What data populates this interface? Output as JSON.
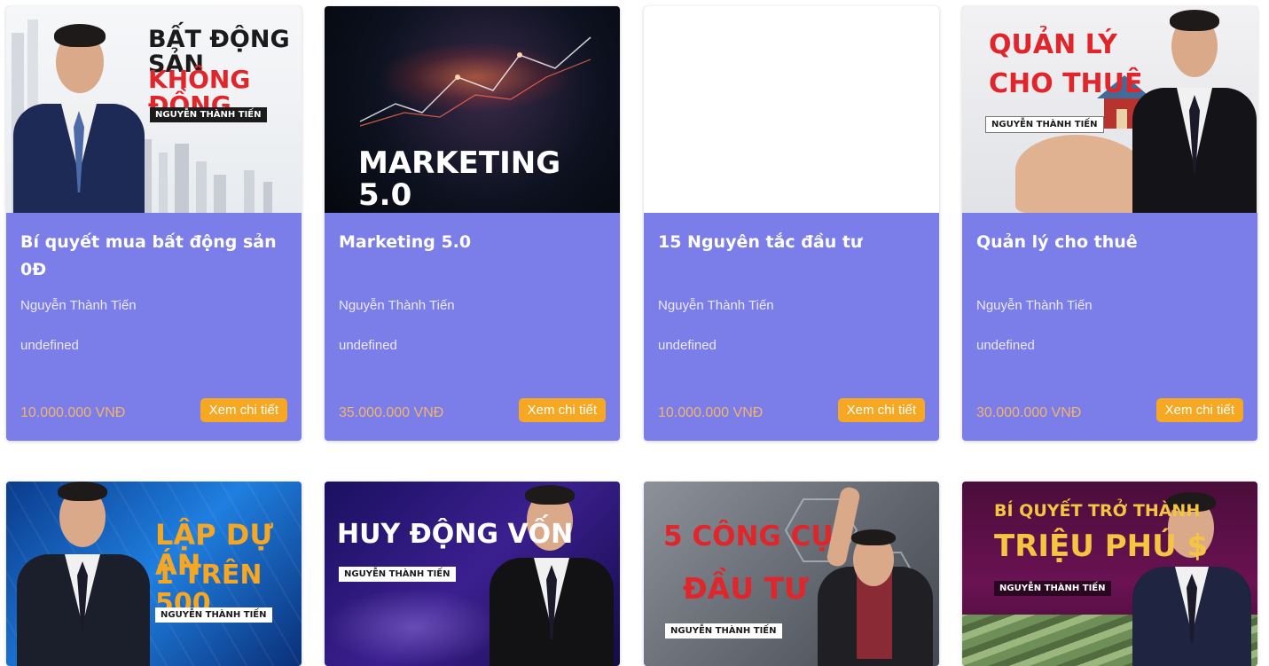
{
  "colors": {
    "card_bg": "#7b7de8",
    "button_bg": "#f7a823",
    "price_text": "#f4b46a"
  },
  "button_label": "Xem chi tiết",
  "courses": [
    {
      "title": "Bí quyết mua bất động sản 0Đ",
      "author": "Nguyễn Thành Tiến",
      "extra": "undefined",
      "price": "10.000.000 VNĐ",
      "banner": {
        "line1": "BẤT ĐỘNG SẢN",
        "line2": "KHÔNG ĐỒNG",
        "tag": "NGUYỄN THÀNH TIẾN"
      }
    },
    {
      "title": "Marketing 5.0",
      "author": "Nguyễn Thành Tiến",
      "extra": "undefined",
      "price": "35.000.000 VNĐ",
      "banner": {
        "line1": "MARKETING 5.0"
      }
    },
    {
      "title": "15 Nguyên tắc đầu tư",
      "author": "Nguyễn Thành Tiến",
      "extra": "undefined",
      "price": "10.000.000 VNĐ",
      "banner": {}
    },
    {
      "title": "Quản lý cho thuê",
      "author": "Nguyễn Thành Tiến",
      "extra": "undefined",
      "price": "30.000.000 VNĐ",
      "banner": {
        "line1": "QUẢN LÝ",
        "line2": "CHO THUÊ",
        "tag": "NGUYỄN THÀNH TIẾN"
      }
    },
    {
      "banner": {
        "line1": "LẬP DỰ ÁN",
        "line2": "1 TRÊN 500",
        "tag": "NGUYỄN THÀNH TIẾN"
      }
    },
    {
      "banner": {
        "line1": "HUY ĐỘNG VỐN",
        "tag": "NGUYỄN THÀNH TIẾN"
      }
    },
    {
      "banner": {
        "line1": "5 CÔNG CỤ",
        "line2": "ĐẦU TƯ",
        "tag": "NGUYỄN THÀNH TIẾN"
      }
    },
    {
      "banner": {
        "line1": "BÍ QUYẾT TRỞ THÀNH",
        "line2": "TRIỆU PHÚ $",
        "tag": "NGUYỄN THÀNH TIẾN"
      }
    }
  ]
}
